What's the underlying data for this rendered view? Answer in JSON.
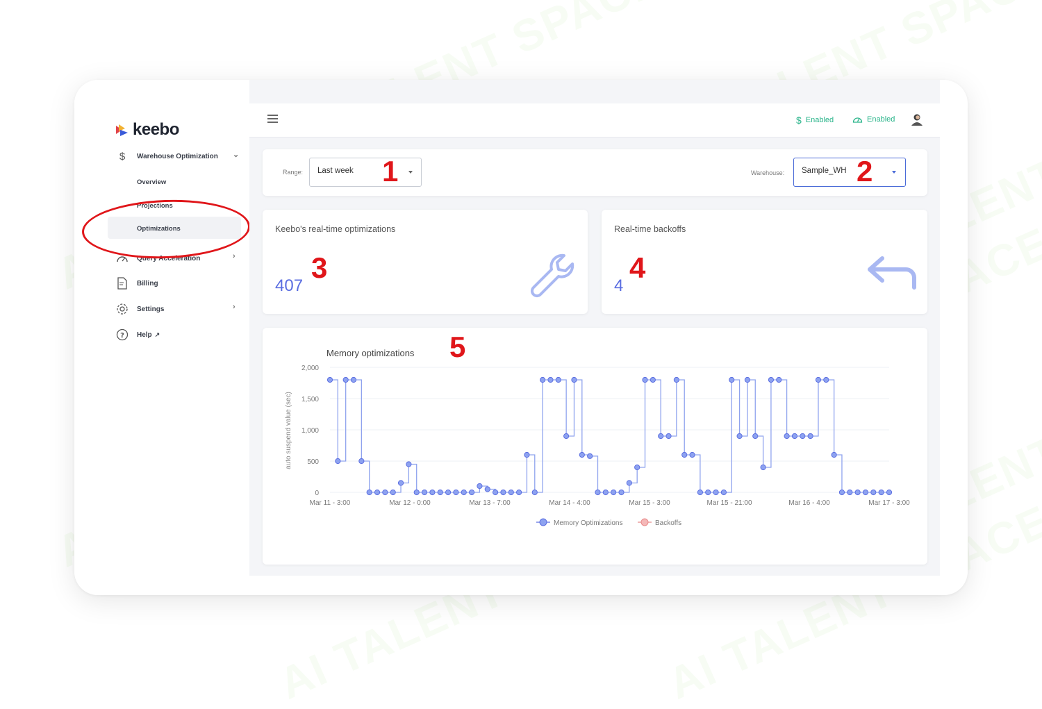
{
  "watermark": "AI TALENT SPACE",
  "brand": {
    "name": "keebo"
  },
  "sidebar": {
    "sections": [
      {
        "label": "Warehouse Optimization",
        "icon": "dollar-icon"
      },
      {
        "label": "Query Acceleration",
        "icon": "speedometer-icon"
      },
      {
        "label": "Billing",
        "icon": "billing-icon"
      },
      {
        "label": "Settings",
        "icon": "gear-icon"
      },
      {
        "label": "Help",
        "icon": "help-icon"
      }
    ],
    "subitems": [
      {
        "label": "Overview"
      },
      {
        "label": "Projections"
      },
      {
        "label": "Optimizations",
        "active": true
      }
    ]
  },
  "topbar": {
    "status": [
      {
        "label": "Enabled",
        "icon": "dollar-icon"
      },
      {
        "label": "Enabled",
        "icon": "gauge-icon"
      }
    ]
  },
  "filters": {
    "range_label": "Range:",
    "range_value": "Last week",
    "warehouse_label": "Warehouse:",
    "warehouse_value": "Sample_WH"
  },
  "stats": {
    "optimizations_title": "Keebo's real-time optimizations",
    "optimizations_value": "407",
    "backoffs_title": "Real-time backoffs",
    "backoffs_value": "4"
  },
  "callouts": [
    "1",
    "2",
    "3",
    "4",
    "5"
  ],
  "colors": {
    "accent": "#5b6ee1",
    "enabled": "#29b48a",
    "callout": "#e0161a",
    "backoffs": "#e88a8a"
  },
  "chart_data": {
    "type": "line",
    "title": "Memory optimizations",
    "xlabel": "",
    "ylabel": "auto suspend value (sec)",
    "ylim": [
      0,
      2000
    ],
    "yticks": [
      0,
      500,
      1000,
      1500,
      2000
    ],
    "ytick_labels": [
      "0",
      "500",
      "1,000",
      "1,500",
      "2,000"
    ],
    "xtick_labels": [
      "Mar 11 - 3:00",
      "Mar 12 - 0:00",
      "Mar 13 - 7:00",
      "Mar 14 - 4:00",
      "Mar 15 - 3:00",
      "Mar 15 - 21:00",
      "Mar 16 - 4:00",
      "Mar 17 - 3:00"
    ],
    "step": true,
    "legend_position": "bottom",
    "series": [
      {
        "name": "Memory Optimizations",
        "values": [
          1800,
          500,
          1800,
          1800,
          500,
          0,
          0,
          0,
          0,
          150,
          450,
          0,
          0,
          0,
          0,
          0,
          0,
          0,
          0,
          100,
          50,
          0,
          0,
          0,
          0,
          600,
          0,
          1800,
          1800,
          1800,
          900,
          1800,
          600,
          580,
          0,
          0,
          0,
          0,
          150,
          400,
          1800,
          1800,
          900,
          900,
          1800,
          600,
          600,
          0,
          0,
          0,
          0,
          1800,
          900,
          1800,
          900,
          400,
          1800,
          1800,
          900,
          900,
          900,
          900,
          1800,
          1800,
          600,
          0,
          0,
          0,
          0,
          0,
          0,
          0
        ]
      },
      {
        "name": "Backoffs",
        "values": []
      }
    ]
  }
}
